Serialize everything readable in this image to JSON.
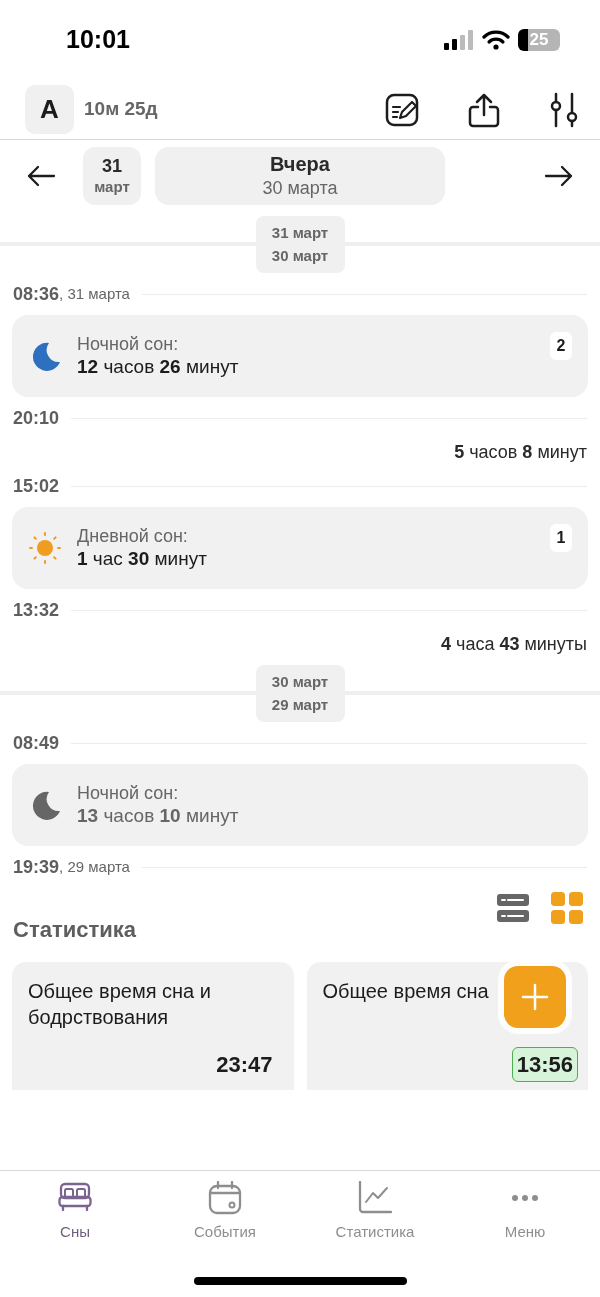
{
  "status_bar": {
    "time": "10:01",
    "battery": "25"
  },
  "header": {
    "avatar": "A",
    "age": "10м 25д"
  },
  "date_nav": {
    "day": "31",
    "month": "март",
    "title": "Вчера",
    "subtitle": "30 марта"
  },
  "timeline": [
    {
      "kind": "divider",
      "from": "31 март",
      "to": "30 март"
    },
    {
      "kind": "time",
      "time": "08:36",
      "date": ", 31 марта"
    },
    {
      "kind": "night_sleep",
      "label": "Ночной сон:",
      "duration": "**12** часов **26** минут",
      "count": "2",
      "muted": false
    },
    {
      "kind": "time",
      "time": "20:10"
    },
    {
      "kind": "gap",
      "duration": "**5** часов **8** минут"
    },
    {
      "kind": "time",
      "time": "15:02"
    },
    {
      "kind": "day_sleep",
      "label": "Дневной сон:",
      "duration": "**1** час **30** минут",
      "count": "1",
      "muted": false
    },
    {
      "kind": "time",
      "time": "13:32"
    },
    {
      "kind": "gap",
      "duration": "**4** часа **43** минуты"
    },
    {
      "kind": "divider",
      "from": "30 март",
      "to": "29 март"
    },
    {
      "kind": "time",
      "time": "08:49"
    },
    {
      "kind": "night_sleep",
      "label": "Ночной сон:",
      "duration": "**13** часов **10** минут",
      "muted": true
    },
    {
      "kind": "time",
      "time": "19:39",
      "date": ", 29 марта"
    }
  ],
  "statistics": {
    "title": "Статистика",
    "views": [
      {
        "kind": "list",
        "selected": false
      },
      {
        "kind": "grid",
        "selected": true
      }
    ],
    "cards": [
      {
        "title": "Общее время сна и бодрствования",
        "value": "23:47",
        "highlight": false
      },
      {
        "title": "Общее время сна",
        "value": "13:56",
        "highlight": true
      }
    ]
  },
  "tabs": [
    {
      "label": "Сны",
      "selected": true
    },
    {
      "label": "События",
      "selected": false
    },
    {
      "label": "Статистика",
      "selected": false
    },
    {
      "label": "Меню",
      "selected": false
    }
  ]
}
